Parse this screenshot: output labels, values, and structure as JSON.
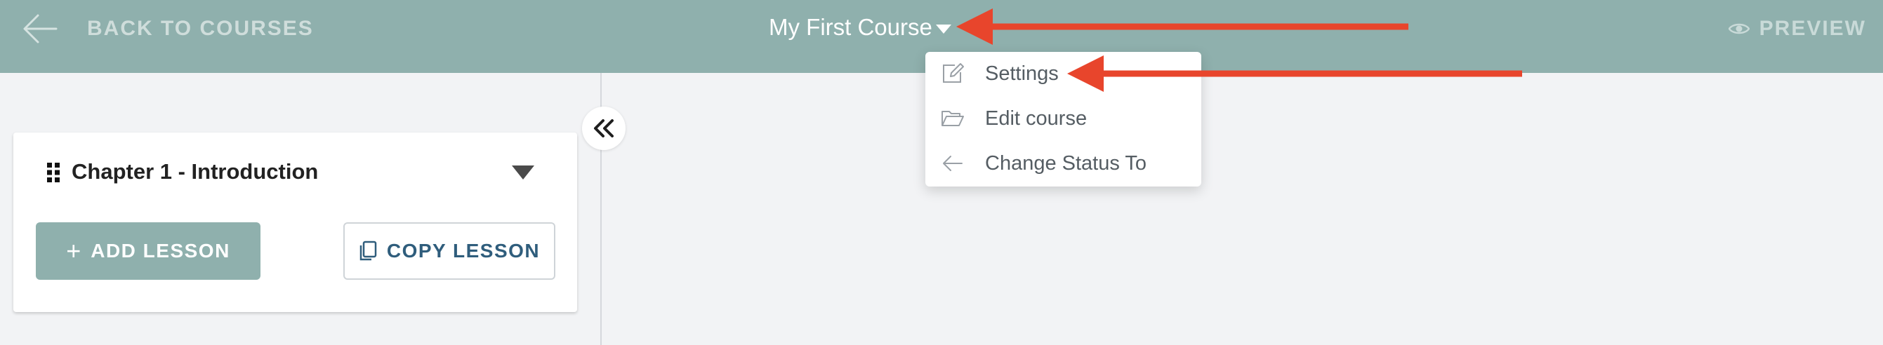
{
  "header": {
    "back_label": "BACK TO COURSES",
    "course_title": "My First Course",
    "preview_label": "PREVIEW"
  },
  "dropdown": {
    "items": [
      {
        "label": "Settings",
        "icon": "pencil-icon"
      },
      {
        "label": "Edit course",
        "icon": "folder-open-icon"
      },
      {
        "label": "Change Status To",
        "icon": "arrow-left-icon"
      }
    ]
  },
  "chapter": {
    "title": "Chapter 1 - Introduction",
    "add_lesson_label": "ADD LESSON",
    "copy_lesson_label": "COPY LESSON"
  },
  "colors": {
    "header_bg": "#8fb0ad",
    "accent_button": "#8fb0ad",
    "copy_text": "#2f5d7c",
    "annotation_arrow": "#e8452c"
  }
}
